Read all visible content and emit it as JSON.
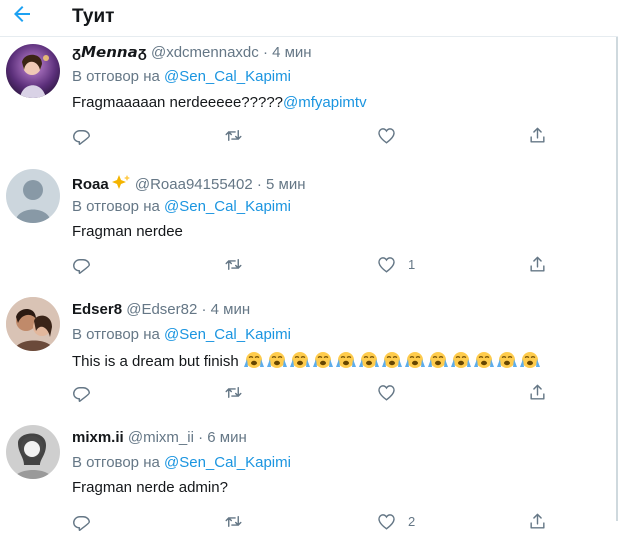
{
  "header": {
    "title": "Туит"
  },
  "tweets": [
    {
      "display_name": "🍶𝕸𝖊𝖓𝖓𝖆🍶",
      "display_name_plain": "ᵹ𝙈𝙚𝙣𝙣𝙖ᵹ",
      "handle": "@xdcmennaxdc",
      "dot": "·",
      "time": "4 мин",
      "reply_prefix": "В отговор на ",
      "reply_to": "@Sen_Cal_Kapimi",
      "text": "Fragmaaaaan nerdeeeee?????",
      "mention": "@mfyapimtv",
      "reply_count": "",
      "retweet_count": "",
      "like_count": ""
    },
    {
      "display_name": "Roaa",
      "handle": "@Roaa94155402",
      "dot": "·",
      "time": "5 мин",
      "reply_prefix": "В отговор на ",
      "reply_to": "@Sen_Cal_Kapimi",
      "text": "Fragman nerdee",
      "reply_count": "",
      "retweet_count": "",
      "like_count": "1"
    },
    {
      "display_name": "Edser8",
      "handle": "@Edser82",
      "dot": "·",
      "time": "4 мин",
      "reply_prefix": "В отговор на ",
      "reply_to": "@Sen_Cal_Kapimi",
      "text": "This is a dream but finish",
      "emoji_name": "loudly-crying-face",
      "emoji_count": 13,
      "reply_count": "",
      "retweet_count": "",
      "like_count": ""
    },
    {
      "display_name": "mixm.ii",
      "handle": "@mixm_ii",
      "dot": "·",
      "time": "6 мин",
      "reply_prefix": "В отговор на ",
      "reply_to": "@Sen_Cal_Kapimi",
      "text": "Fragman nerde admin?",
      "reply_count": "",
      "retweet_count": "",
      "like_count": "2"
    }
  ],
  "icons": {
    "back": "arrow-left-icon",
    "reply": "reply-icon",
    "retweet": "retweet-icon",
    "like": "heart-icon",
    "share": "share-icon",
    "badge": "sparkles-icon"
  },
  "colors": {
    "accent": "#1da1f2",
    "link": "#1b95e0",
    "muted": "#657786",
    "text": "#14171a",
    "border": "#e6ecf0"
  }
}
